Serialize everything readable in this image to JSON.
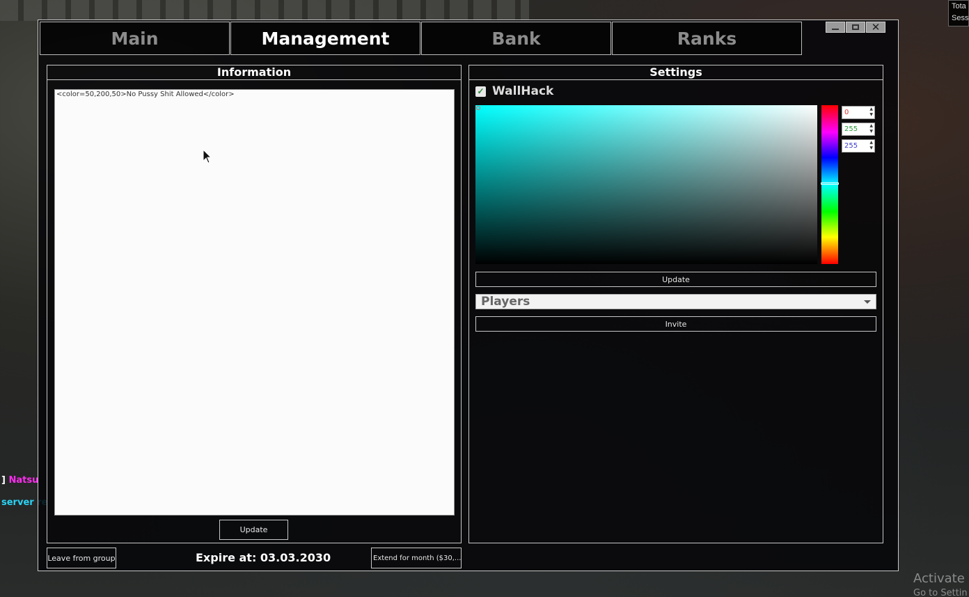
{
  "background": {
    "hud_lines": [
      "Tota",
      "Sess"
    ],
    "chat": [
      {
        "prefix": "] ",
        "name": "Natsu"
      },
      {
        "text": "server re"
      }
    ],
    "watermark_title": "Activate W",
    "watermark_sub": "Go to Settin"
  },
  "window": {
    "controls": [
      "minimize-icon",
      "maximize-icon",
      "close-icon"
    ],
    "close_glyph": "✕"
  },
  "tabs": [
    {
      "label": "Main",
      "active": false
    },
    {
      "label": "Management",
      "active": true
    },
    {
      "label": "Bank",
      "active": false
    },
    {
      "label": "Ranks",
      "active": false
    }
  ],
  "information": {
    "title": "Information",
    "text": "<color=50,200,50>No Pussy Shit Allowed</color>",
    "update_label": "Update"
  },
  "settings": {
    "title": "Settings",
    "wallhack_label": "WallHack",
    "wallhack_checked": true,
    "color": {
      "r": "0",
      "g": "255",
      "b": "255",
      "hex": "#00ffff"
    },
    "update_label": "Update",
    "players_placeholder": "Players",
    "invite_label": "Invite"
  },
  "footer": {
    "leave_label": "Leave from group",
    "expire_text": "Expire at: 03.03.2030",
    "extend_label": "Extend for month ($30,..."
  }
}
